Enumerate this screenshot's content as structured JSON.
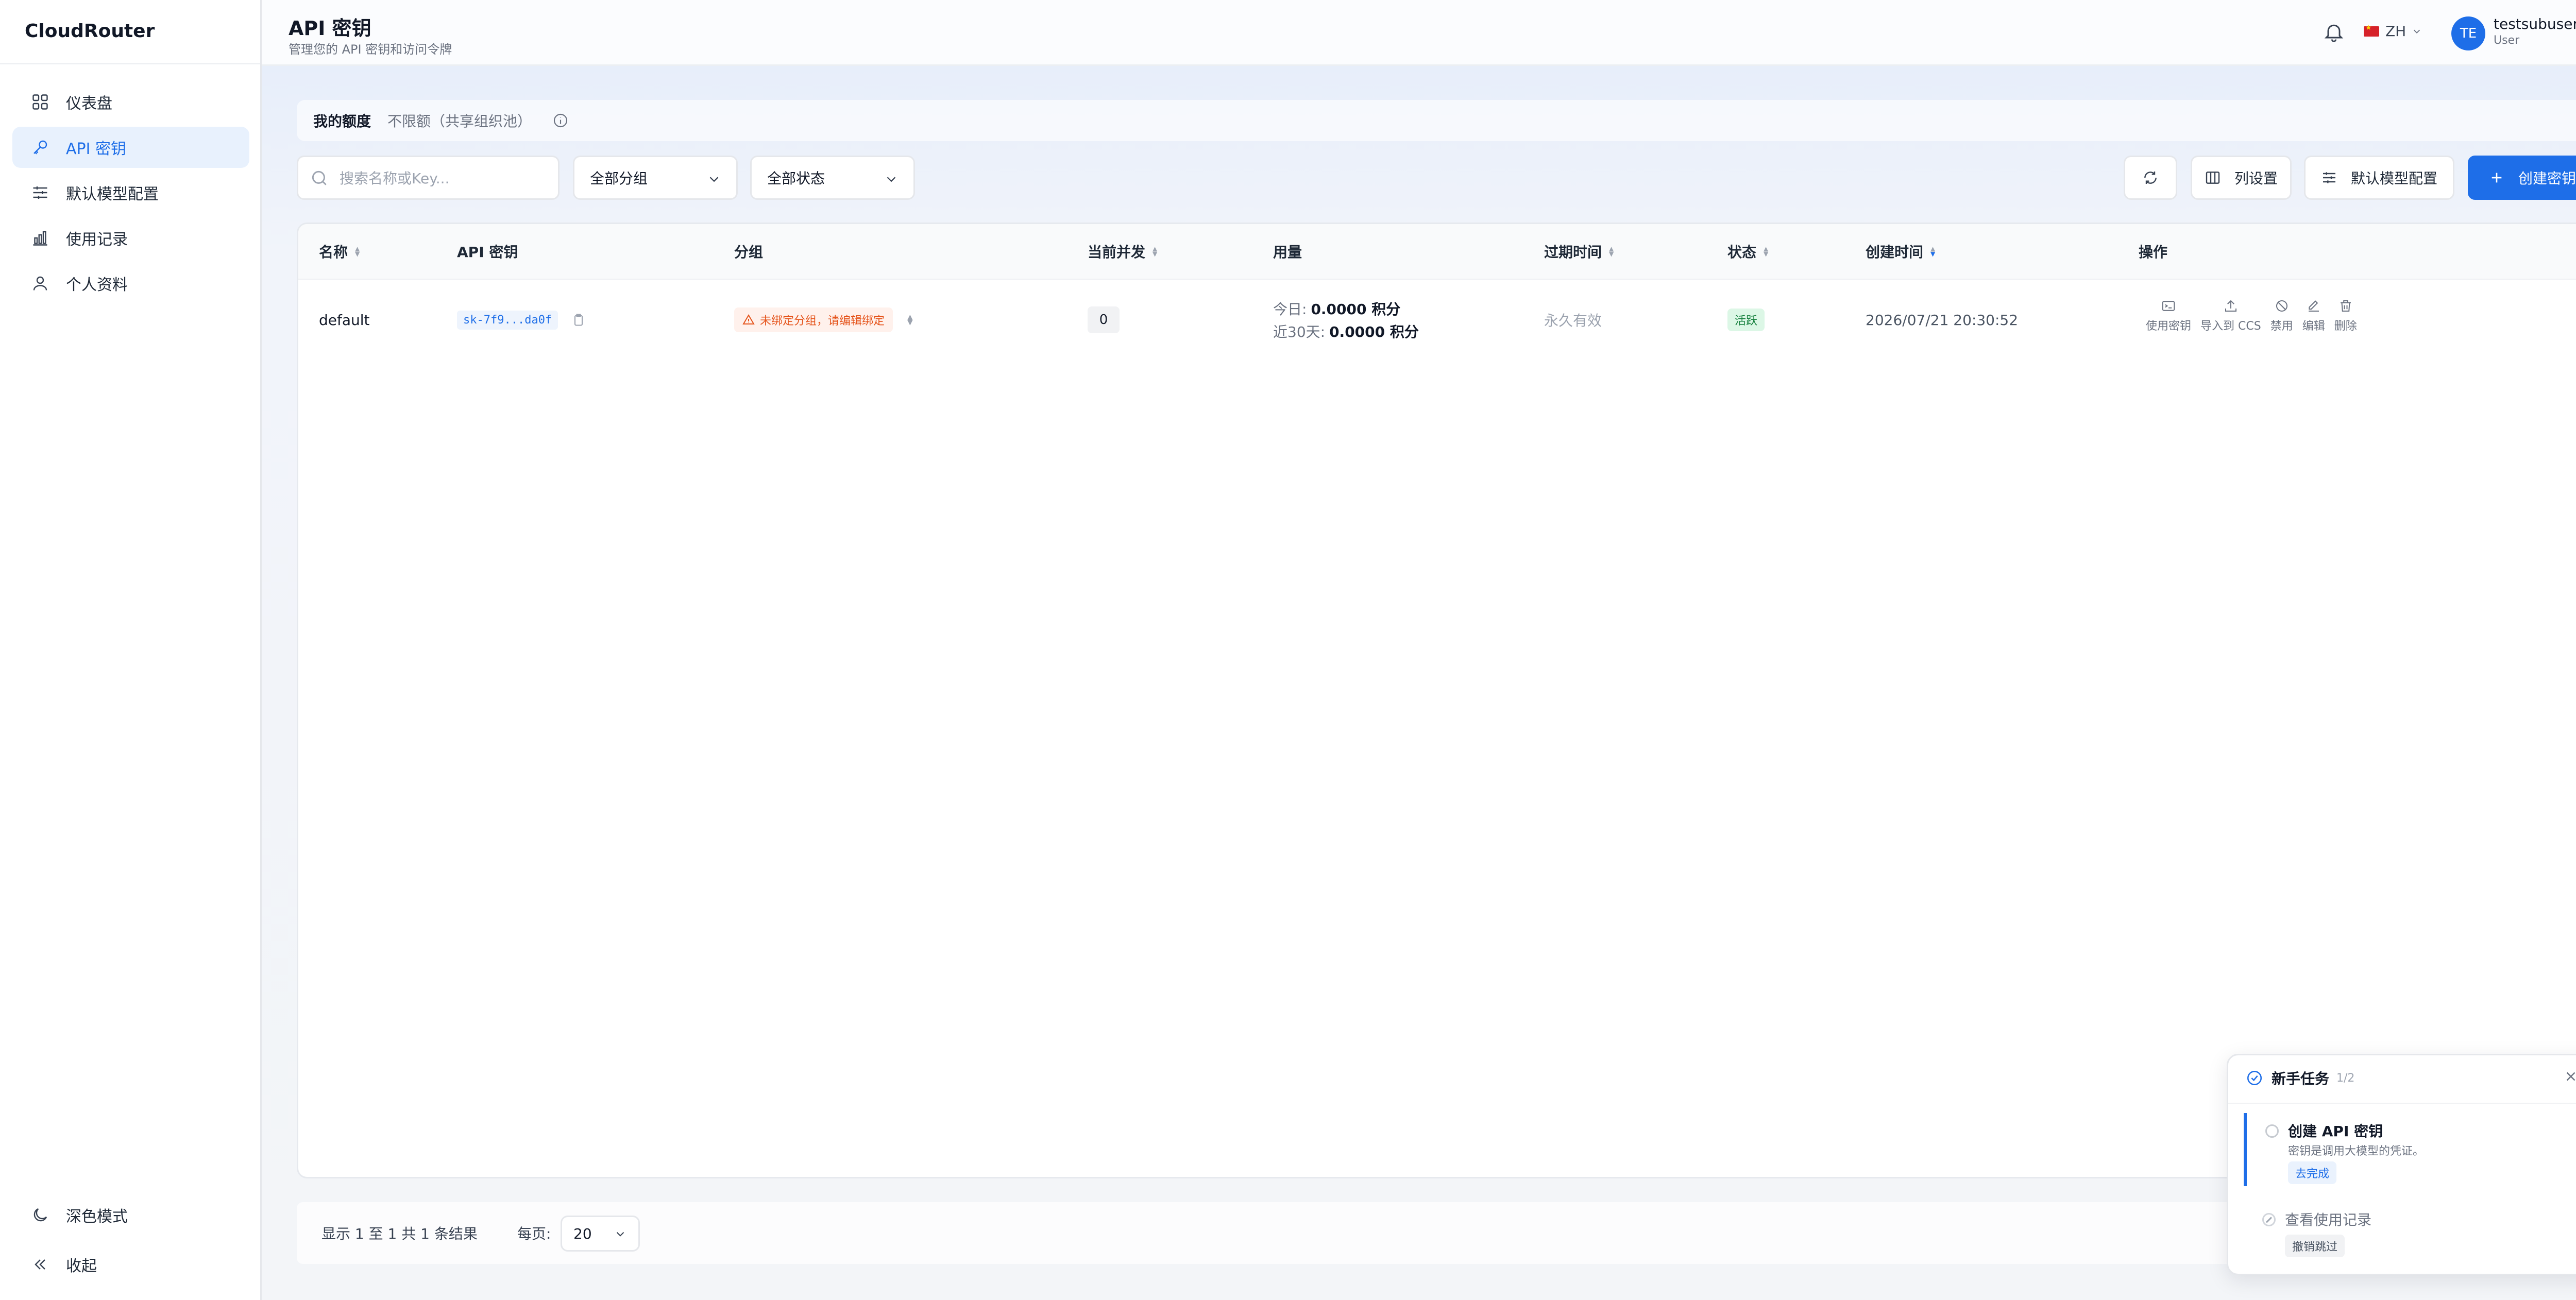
{
  "brand": {
    "name": "CloudRouter"
  },
  "sidebar": {
    "items": [
      {
        "label": "仪表盘",
        "icon": "dashboard-icon"
      },
      {
        "label": "API 密钥",
        "icon": "key-icon",
        "active": true
      },
      {
        "label": "默认模型配置",
        "icon": "sliders-icon"
      },
      {
        "label": "使用记录",
        "icon": "bar-chart-icon"
      },
      {
        "label": "个人资料",
        "icon": "user-icon"
      }
    ],
    "bottom": [
      {
        "label": "深色模式",
        "icon": "moon-icon"
      },
      {
        "label": "收起",
        "icon": "collapse-icon"
      }
    ]
  },
  "header": {
    "title": "API 密钥",
    "subtitle": "管理您的 API 密钥和访问令牌",
    "lang": "ZH",
    "user": {
      "initials": "TE",
      "name": "testsubuser",
      "role": "User"
    }
  },
  "quota": {
    "label": "我的额度",
    "value": "不限额（共享组织池）"
  },
  "toolbar": {
    "search_placeholder": "搜索名称或Key...",
    "group_filter": "全部分组",
    "status_filter": "全部状态",
    "columns_label": "列设置",
    "default_model_label": "默认模型配置",
    "create_label": "创建密钥"
  },
  "table": {
    "columns": {
      "name": "名称",
      "key": "API 密钥",
      "group": "分组",
      "concurrency": "当前并发",
      "usage": "用量",
      "expires": "过期时间",
      "status": "状态",
      "created": "创建时间",
      "actions": "操作"
    },
    "rows": [
      {
        "name": "default",
        "key": "sk-7f9...da0f",
        "group_warning": "未绑定分组，请编辑绑定",
        "concurrency": "0",
        "usage_today_label": "今日:",
        "usage_today": "0.0000 积分",
        "usage_30d_label": "近30天:",
        "usage_30d": "0.0000 积分",
        "expires": "永久有效",
        "status": "活跃",
        "created": "2026/07/21 20:30:52",
        "actions": [
          "使用密钥",
          "导入到 CCS",
          "禁用",
          "编辑",
          "删除"
        ]
      }
    ]
  },
  "pagination": {
    "info": "显示 1 至 1 共 1 条结果",
    "per_page_label": "每页:",
    "page_size": "20"
  },
  "onboarding": {
    "title": "新手任务",
    "progress": "1/2",
    "tasks": [
      {
        "title": "创建 API 密钥",
        "desc": "密钥是调用大模型的凭证。",
        "action": "去完成"
      },
      {
        "title": "查看使用记录",
        "action": "撤销跳过"
      }
    ]
  },
  "colors": {
    "accent": "#1e6ee8",
    "warning": "#e5531a",
    "success": "#15803d"
  }
}
